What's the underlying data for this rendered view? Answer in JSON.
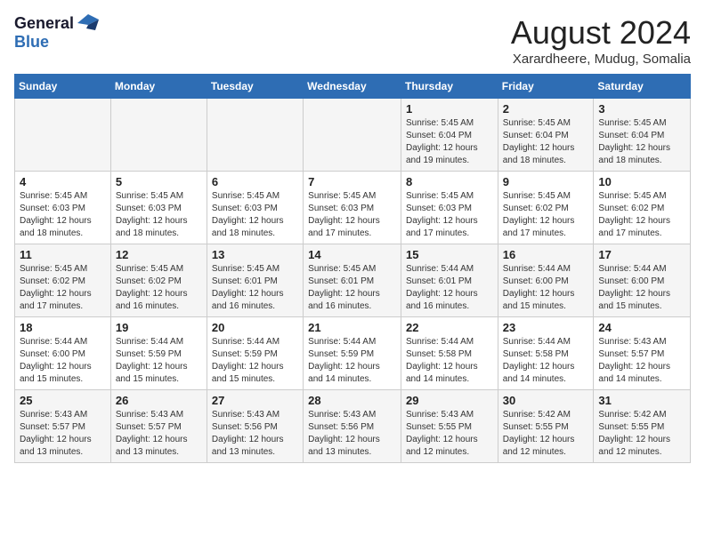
{
  "header": {
    "logo_line1": "General",
    "logo_line2": "Blue",
    "month": "August 2024",
    "location": "Xarardheere, Mudug, Somalia"
  },
  "weekdays": [
    "Sunday",
    "Monday",
    "Tuesday",
    "Wednesday",
    "Thursday",
    "Friday",
    "Saturday"
  ],
  "weeks": [
    [
      {
        "day": "",
        "info": ""
      },
      {
        "day": "",
        "info": ""
      },
      {
        "day": "",
        "info": ""
      },
      {
        "day": "",
        "info": ""
      },
      {
        "day": "1",
        "info": "Sunrise: 5:45 AM\nSunset: 6:04 PM\nDaylight: 12 hours\nand 19 minutes."
      },
      {
        "day": "2",
        "info": "Sunrise: 5:45 AM\nSunset: 6:04 PM\nDaylight: 12 hours\nand 18 minutes."
      },
      {
        "day": "3",
        "info": "Sunrise: 5:45 AM\nSunset: 6:04 PM\nDaylight: 12 hours\nand 18 minutes."
      }
    ],
    [
      {
        "day": "4",
        "info": "Sunrise: 5:45 AM\nSunset: 6:03 PM\nDaylight: 12 hours\nand 18 minutes."
      },
      {
        "day": "5",
        "info": "Sunrise: 5:45 AM\nSunset: 6:03 PM\nDaylight: 12 hours\nand 18 minutes."
      },
      {
        "day": "6",
        "info": "Sunrise: 5:45 AM\nSunset: 6:03 PM\nDaylight: 12 hours\nand 18 minutes."
      },
      {
        "day": "7",
        "info": "Sunrise: 5:45 AM\nSunset: 6:03 PM\nDaylight: 12 hours\nand 17 minutes."
      },
      {
        "day": "8",
        "info": "Sunrise: 5:45 AM\nSunset: 6:03 PM\nDaylight: 12 hours\nand 17 minutes."
      },
      {
        "day": "9",
        "info": "Sunrise: 5:45 AM\nSunset: 6:02 PM\nDaylight: 12 hours\nand 17 minutes."
      },
      {
        "day": "10",
        "info": "Sunrise: 5:45 AM\nSunset: 6:02 PM\nDaylight: 12 hours\nand 17 minutes."
      }
    ],
    [
      {
        "day": "11",
        "info": "Sunrise: 5:45 AM\nSunset: 6:02 PM\nDaylight: 12 hours\nand 17 minutes."
      },
      {
        "day": "12",
        "info": "Sunrise: 5:45 AM\nSunset: 6:02 PM\nDaylight: 12 hours\nand 16 minutes."
      },
      {
        "day": "13",
        "info": "Sunrise: 5:45 AM\nSunset: 6:01 PM\nDaylight: 12 hours\nand 16 minutes."
      },
      {
        "day": "14",
        "info": "Sunrise: 5:45 AM\nSunset: 6:01 PM\nDaylight: 12 hours\nand 16 minutes."
      },
      {
        "day": "15",
        "info": "Sunrise: 5:44 AM\nSunset: 6:01 PM\nDaylight: 12 hours\nand 16 minutes."
      },
      {
        "day": "16",
        "info": "Sunrise: 5:44 AM\nSunset: 6:00 PM\nDaylight: 12 hours\nand 15 minutes."
      },
      {
        "day": "17",
        "info": "Sunrise: 5:44 AM\nSunset: 6:00 PM\nDaylight: 12 hours\nand 15 minutes."
      }
    ],
    [
      {
        "day": "18",
        "info": "Sunrise: 5:44 AM\nSunset: 6:00 PM\nDaylight: 12 hours\nand 15 minutes."
      },
      {
        "day": "19",
        "info": "Sunrise: 5:44 AM\nSunset: 5:59 PM\nDaylight: 12 hours\nand 15 minutes."
      },
      {
        "day": "20",
        "info": "Sunrise: 5:44 AM\nSunset: 5:59 PM\nDaylight: 12 hours\nand 15 minutes."
      },
      {
        "day": "21",
        "info": "Sunrise: 5:44 AM\nSunset: 5:59 PM\nDaylight: 12 hours\nand 14 minutes."
      },
      {
        "day": "22",
        "info": "Sunrise: 5:44 AM\nSunset: 5:58 PM\nDaylight: 12 hours\nand 14 minutes."
      },
      {
        "day": "23",
        "info": "Sunrise: 5:44 AM\nSunset: 5:58 PM\nDaylight: 12 hours\nand 14 minutes."
      },
      {
        "day": "24",
        "info": "Sunrise: 5:43 AM\nSunset: 5:57 PM\nDaylight: 12 hours\nand 14 minutes."
      }
    ],
    [
      {
        "day": "25",
        "info": "Sunrise: 5:43 AM\nSunset: 5:57 PM\nDaylight: 12 hours\nand 13 minutes."
      },
      {
        "day": "26",
        "info": "Sunrise: 5:43 AM\nSunset: 5:57 PM\nDaylight: 12 hours\nand 13 minutes."
      },
      {
        "day": "27",
        "info": "Sunrise: 5:43 AM\nSunset: 5:56 PM\nDaylight: 12 hours\nand 13 minutes."
      },
      {
        "day": "28",
        "info": "Sunrise: 5:43 AM\nSunset: 5:56 PM\nDaylight: 12 hours\nand 13 minutes."
      },
      {
        "day": "29",
        "info": "Sunrise: 5:43 AM\nSunset: 5:55 PM\nDaylight: 12 hours\nand 12 minutes."
      },
      {
        "day": "30",
        "info": "Sunrise: 5:42 AM\nSunset: 5:55 PM\nDaylight: 12 hours\nand 12 minutes."
      },
      {
        "day": "31",
        "info": "Sunrise: 5:42 AM\nSunset: 5:55 PM\nDaylight: 12 hours\nand 12 minutes."
      }
    ]
  ]
}
